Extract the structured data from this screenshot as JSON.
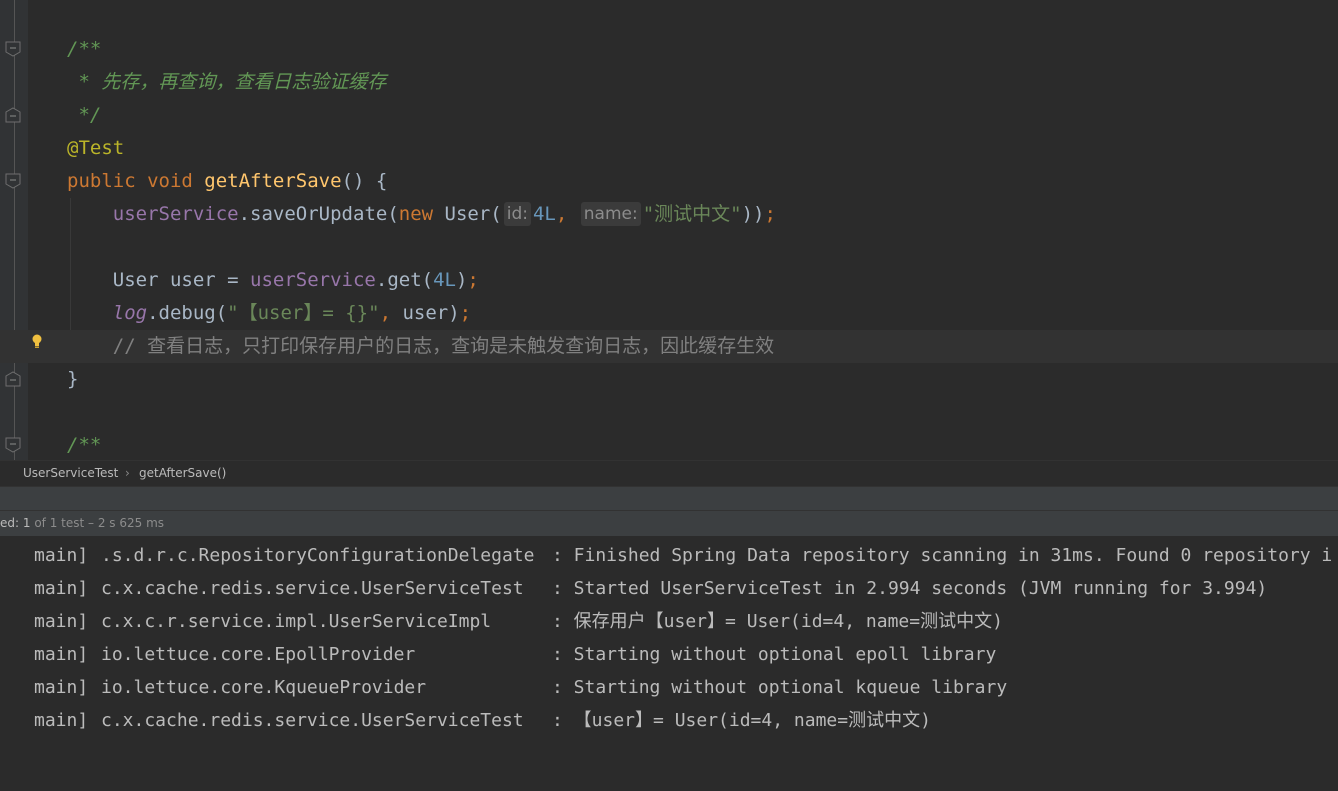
{
  "editor": {
    "lines": [
      {
        "segments": [
          {
            "t": "/**",
            "c": "c-doc"
          }
        ]
      },
      {
        "segments": [
          {
            "t": " * 先存，再查询，查看日志验证缓存",
            "c": "c-doc"
          }
        ]
      },
      {
        "segments": [
          {
            "t": " */",
            "c": "c-doc"
          }
        ]
      },
      {
        "segments": [
          {
            "t": "@Test",
            "c": "c-anno"
          }
        ]
      },
      {
        "segments": [
          {
            "t": "public ",
            "c": "c-kw"
          },
          {
            "t": "void ",
            "c": "c-kw"
          },
          {
            "t": "getAfterSave",
            "c": "c-fn"
          },
          {
            "t": "() {",
            "c": ""
          }
        ]
      },
      {
        "segments": [
          {
            "t": "    ",
            "c": ""
          },
          {
            "t": "userService",
            "c": "c-field"
          },
          {
            "t": ".saveOrUpdate(",
            "c": ""
          },
          {
            "t": "new ",
            "c": "c-kw"
          },
          {
            "t": "User(",
            "c": ""
          },
          {
            "t": "id:",
            "hint": true
          },
          {
            "t": "4L",
            "c": "c-num"
          },
          {
            "t": ", ",
            "c": "c-kw"
          },
          {
            "t": "name:",
            "hint": true
          },
          {
            "t": "\"测试中文\"",
            "c": "c-str"
          },
          {
            "t": "))",
            "c": ""
          },
          {
            "t": ";",
            "c": "c-kw"
          }
        ]
      },
      {
        "segments": [
          {
            "t": "",
            "c": ""
          }
        ]
      },
      {
        "segments": [
          {
            "t": "    User user = ",
            "c": ""
          },
          {
            "t": "userService",
            "c": "c-field"
          },
          {
            "t": ".get(",
            "c": ""
          },
          {
            "t": "4L",
            "c": "c-num"
          },
          {
            "t": ")",
            "c": ""
          },
          {
            "t": ";",
            "c": "c-kw"
          }
        ]
      },
      {
        "segments": [
          {
            "t": "    ",
            "c": ""
          },
          {
            "t": "log",
            "c": "c-static"
          },
          {
            "t": ".debug(",
            "c": ""
          },
          {
            "t": "\"【user】= {}\"",
            "c": "c-str"
          },
          {
            "t": ", ",
            "c": "c-kw"
          },
          {
            "t": "user)",
            "c": ""
          },
          {
            "t": ";",
            "c": "c-kw"
          }
        ]
      },
      {
        "segments": [
          {
            "t": "    // 查看日志，只打印保存用户的日志，查询是未触发查询日志，因此缓存生效",
            "c": "c-comment"
          }
        ],
        "current": true
      },
      {
        "segments": [
          {
            "t": "}",
            "c": ""
          }
        ]
      },
      {
        "segments": [
          {
            "t": "",
            "c": ""
          }
        ]
      },
      {
        "segments": [
          {
            "t": "/**",
            "c": "c-doc"
          }
        ]
      }
    ]
  },
  "breadcrumb": {
    "items": [
      "UserServiceTest",
      "getAfterSave()"
    ],
    "separator": "›"
  },
  "status": {
    "prefix": "ed: ",
    "passed": "1",
    "of": " of ",
    "total": "1 test",
    "duration": " – 2 s 625 ms"
  },
  "console": {
    "lines": [
      {
        "thread": "main]",
        "logger": ".s.d.r.c.RepositoryConfigurationDelegate",
        "message": ": Finished Spring Data repository scanning in 31ms. Found 0 repository i"
      },
      {
        "thread": "main]",
        "logger": "c.x.cache.redis.service.UserServiceTest",
        "message": ": Started UserServiceTest in 2.994 seconds (JVM running for 3.994)"
      },
      {
        "thread": "main]",
        "logger": "c.x.c.r.service.impl.UserServiceImpl",
        "message": ": 保存用户【user】= User(id=4, name=测试中文)"
      },
      {
        "thread": "main]",
        "logger": "io.lettuce.core.EpollProvider",
        "message": ": Starting without optional epoll library"
      },
      {
        "thread": "main]",
        "logger": "io.lettuce.core.KqueueProvider",
        "message": ": Starting without optional kqueue library"
      },
      {
        "thread": "main]",
        "logger": "c.x.cache.redis.service.UserServiceTest",
        "message": ": 【user】= User(id=4, name=测试中文)"
      }
    ]
  },
  "colors": {
    "background": "#2b2b2b",
    "doc_comment": "#629755",
    "keyword": "#cc7832",
    "method": "#ffc66d",
    "field": "#9876aa",
    "number": "#6897bb",
    "string": "#6a8759",
    "annotation": "#bbb529",
    "bulb": "#f0c040"
  }
}
